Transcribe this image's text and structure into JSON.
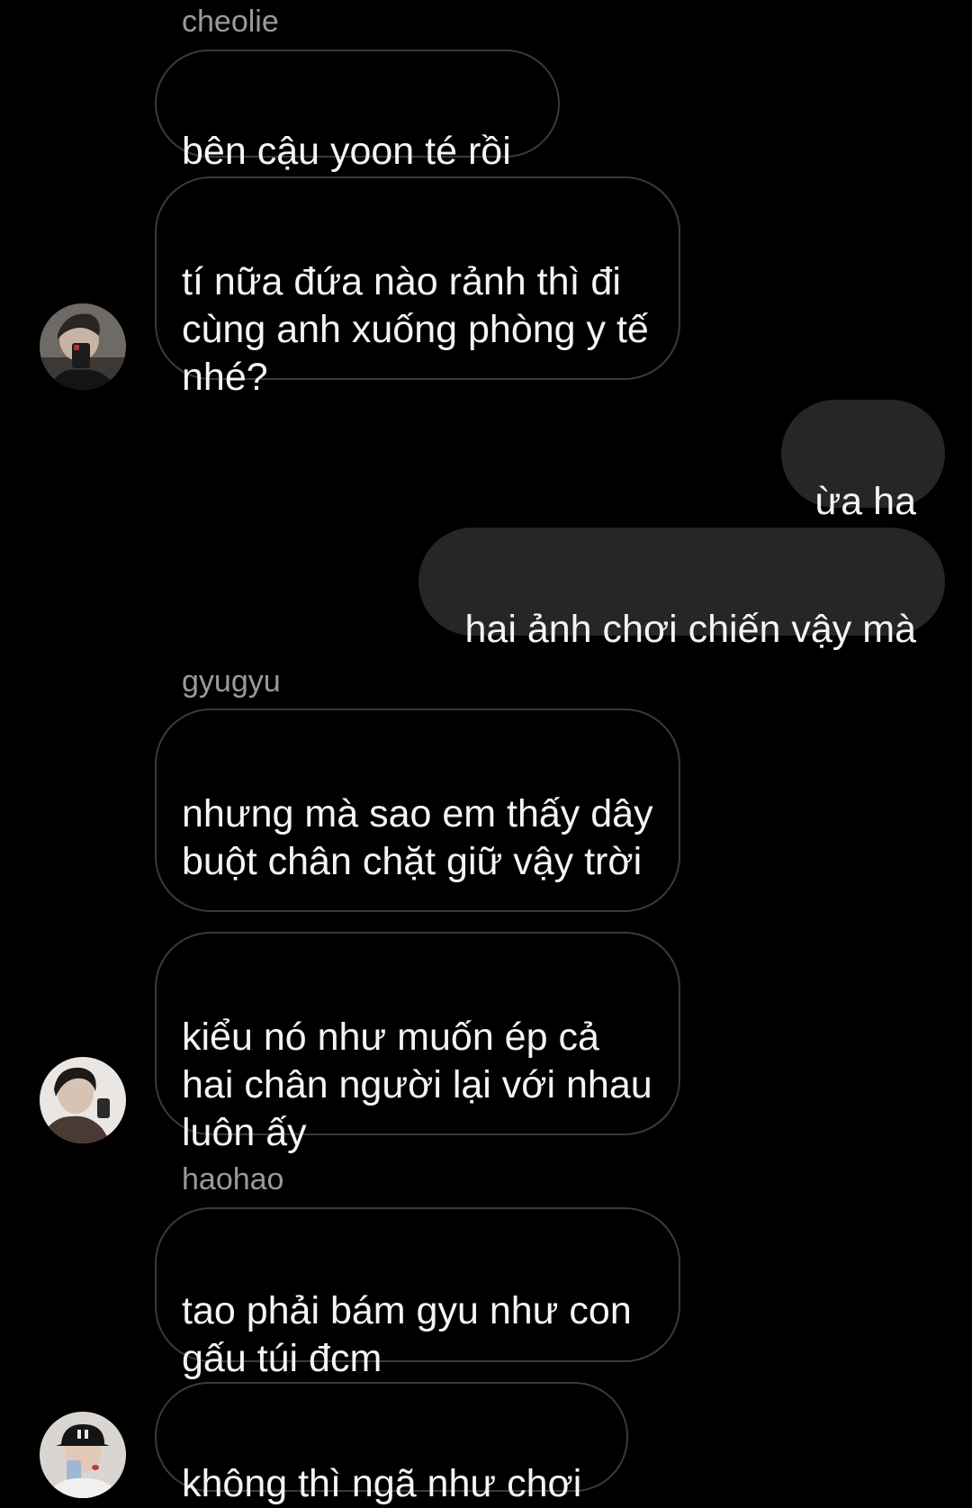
{
  "chat": {
    "messages": [
      {
        "sender": "cheolie",
        "text": "bên cậu yoon té rồi"
      },
      {
        "text": "tí nữa đứa nào rảnh thì đi cùng anh xuống phòng y tế nhé?"
      },
      {
        "text": "ừa ha"
      },
      {
        "text": "hai ảnh chơi chiến vậy mà"
      },
      {
        "sender": "gyugyu",
        "text": "nhưng mà sao em thấy dây buột chân chặt giữ vậy trời"
      },
      {
        "text": "kiểu nó như muốn ép cả hai chân người lại với nhau luôn ấy"
      },
      {
        "sender": "haohao",
        "text": "tao phải bám gyu như con gấu túi đcm"
      },
      {
        "text": "không thì ngã như chơi"
      }
    ]
  },
  "colors": {
    "background": "#000000",
    "incoming_bubble_border": "#3a3a3a",
    "outgoing_bubble": "#262626",
    "sender_name": "#9a9a9a",
    "message_text": "#f4f4f4"
  }
}
